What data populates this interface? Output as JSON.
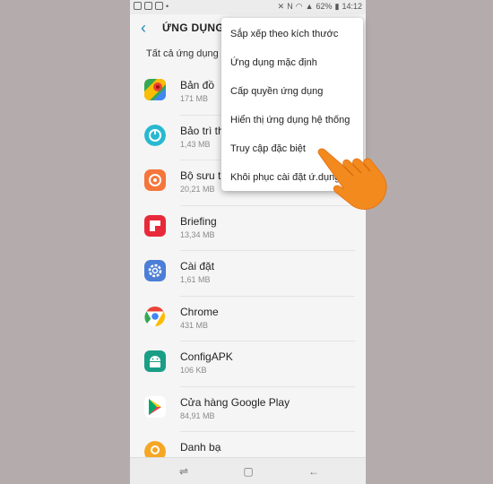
{
  "status_bar": {
    "battery": "62%",
    "time": "14:12"
  },
  "header": {
    "title": "ỨNG DỤNG"
  },
  "filter": {
    "label": "Tất cả ứng dụng"
  },
  "apps": [
    {
      "name": "Bản đồ",
      "size": "171 MB",
      "icon": "maps-icon"
    },
    {
      "name": "Bảo trì thiết bị",
      "size": "1,43 MB",
      "icon": "device-maintenance-icon"
    },
    {
      "name": "Bộ sưu tập",
      "size": "20,21 MB",
      "icon": "gallery-icon"
    },
    {
      "name": "Briefing",
      "size": "13,34 MB",
      "icon": "briefing-icon"
    },
    {
      "name": "Cài đặt",
      "size": "1,61 MB",
      "icon": "settings-icon"
    },
    {
      "name": "Chrome",
      "size": "431 MB",
      "icon": "chrome-icon"
    },
    {
      "name": "ConfigAPK",
      "size": "106 KB",
      "icon": "android-icon"
    },
    {
      "name": "Cửa hàng Google Play",
      "size": "84,91 MB",
      "icon": "play-store-icon"
    },
    {
      "name": "Danh bạ",
      "size": "",
      "icon": "contacts-icon"
    }
  ],
  "menu": {
    "items": [
      "Sắp xếp theo kích thước",
      "Ứng dụng mặc định",
      "Cấp quyền ứng dụng",
      "Hiển thị ứng dụng hệ thống",
      "Truy cập đặc biệt",
      "Khôi phục cài đặt ứ.dụng"
    ]
  },
  "colors": {
    "accent": "#1e88b8",
    "hand": "#f28a1e"
  }
}
